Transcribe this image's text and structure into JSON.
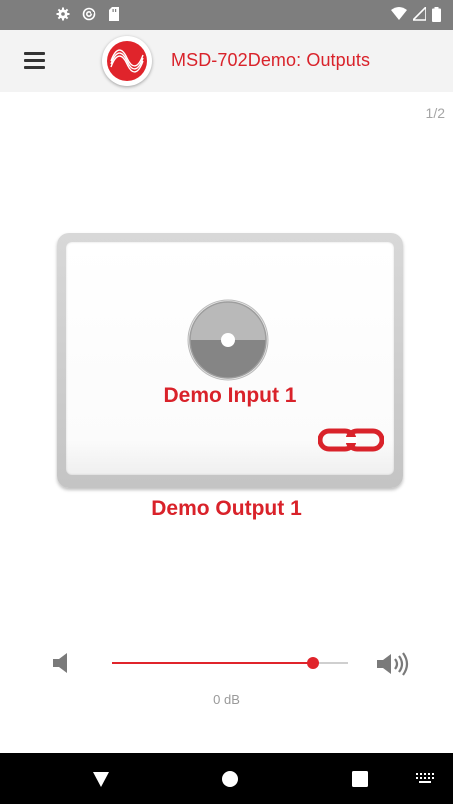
{
  "status_bar": {
    "left_icons": [
      "gear-icon",
      "sync-icon",
      "sd-card-icon"
    ],
    "right_icons": [
      "wifi-icon",
      "signal-icon",
      "battery-icon"
    ]
  },
  "app_bar": {
    "title": "MSD-702Demo: Outputs",
    "menu_icon": "hamburger-menu-icon",
    "logo_icon": "brand-wave-logo"
  },
  "page_indicator": "1/2",
  "output_card": {
    "input_name": "Demo Input 1",
    "input_icon": "disc-icon",
    "link_icon": "chain-link-icon",
    "output_name": "Demo Output 1"
  },
  "volume": {
    "down_icon": "speaker-low-icon",
    "up_icon": "speaker-high-icon",
    "level_fraction": 0.85,
    "label": "0 dB"
  },
  "nav_bar": {
    "icons": [
      "back-icon",
      "home-icon",
      "recents-icon",
      "keyboard-icon"
    ]
  },
  "colors": {
    "accent": "#d9222a",
    "app_bar_bg": "#f3f3f3",
    "status_bar_bg": "#7e7e7e",
    "nav_bar_bg": "#000000"
  }
}
